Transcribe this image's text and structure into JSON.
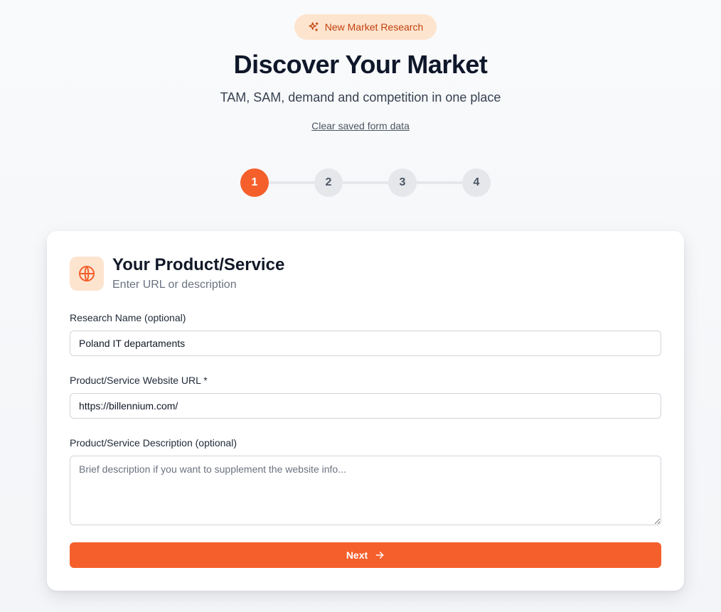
{
  "header": {
    "badge": {
      "icon": "sparkles-icon",
      "label": "New Market Research"
    },
    "title": "Discover Your Market",
    "subtitle": "TAM, SAM, demand and competition in one place",
    "clear_link": "Clear saved form data"
  },
  "stepper": {
    "current_step": 1,
    "steps": [
      "1",
      "2",
      "3",
      "4"
    ]
  },
  "card": {
    "icon": "globe-icon",
    "title": "Your Product/Service",
    "subtitle": "Enter URL or description",
    "fields": {
      "research_name": {
        "label": "Research Name (optional)",
        "value": "Poland IT departaments",
        "placeholder": ""
      },
      "website_url": {
        "label": "Product/Service Website URL *",
        "value": "https://billennium.com/",
        "placeholder": ""
      },
      "description": {
        "label": "Product/Service Description (optional)",
        "value": "",
        "placeholder": "Brief description if you want to supplement the website info..."
      }
    },
    "next_button": {
      "label": "Next",
      "icon": "arrow-right-icon"
    }
  },
  "colors": {
    "accent": "#f55f2c",
    "accent_soft": "#fde4cf",
    "badge_text": "#c2410c",
    "step_inactive": "#e5e7eb"
  }
}
